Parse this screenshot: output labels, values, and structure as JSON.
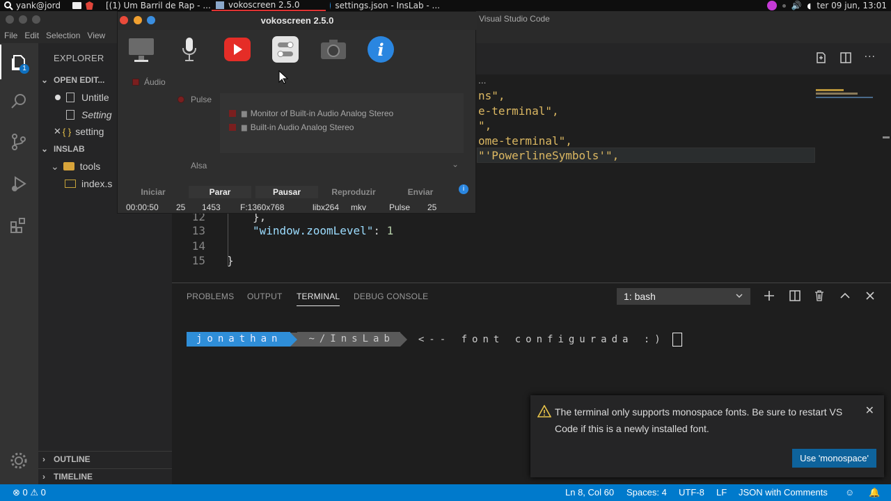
{
  "sysbar": {
    "user": "yank@jord",
    "tasks": [
      "[(1) Um Barril de Rap - ...",
      "vokoscreen 2.5.0",
      "settings.json - InsLab - ..."
    ],
    "clock": "ter 09 jun, 13:01"
  },
  "vscode": {
    "title": "Visual Studio Code",
    "menu": [
      "File",
      "Edit",
      "Selection",
      "View"
    ],
    "explorer": {
      "title": "EXPLORER",
      "open_editors": "OPEN EDIT...",
      "files": [
        "Untitle",
        "Setting",
        "setting"
      ],
      "workspace": "INSLAB",
      "folder": "tools",
      "file": "index.s",
      "outline": "OUTLINE",
      "timeline": "TIMELINE"
    },
    "activity_badge": "1",
    "breadcrumb": "...",
    "code": {
      "frag1": "ns\",",
      "frag2": "e-terminal\",",
      "frag3": "\",",
      "frag4": "ome-terminal\",",
      "frag5": "\"'PowerlineSymbols'\",",
      "line12_num": "12",
      "line12": "},",
      "line13_num": "13",
      "line13_key": "\"window.zoomLevel\"",
      "line13_colon": ": ",
      "line13_val": "1",
      "line14_num": "14",
      "line15_num": "15",
      "line15": "}"
    },
    "panel": {
      "tabs": [
        "PROBLEMS",
        "OUTPUT",
        "TERMINAL",
        "DEBUG CONSOLE"
      ],
      "terminal_select": "1: bash",
      "prompt_user": "jonathan",
      "prompt_dir": "~/InsLab",
      "prompt_rest": "<-- font configurada :)"
    },
    "notification": {
      "message": "The terminal only supports monospace fonts. Be sure to restart VS Code if this is a newly installed font.",
      "button": "Use 'monospace'"
    },
    "status": {
      "errors": "0",
      "warnings": "0",
      "position": "Ln 8, Col 60",
      "spaces": "Spaces: 4",
      "encoding": "UTF-8",
      "eol": "LF",
      "language": "JSON with Comments"
    }
  },
  "voko": {
    "title": "vokoscreen 2.5.0",
    "audio_label": "Áudio",
    "pulse_label": "Pulse",
    "alsa_label": "Alsa",
    "devices": [
      "Monitor of Built-in Audio Analog Stereo",
      "Built-in Audio Analog Stereo"
    ],
    "buttons": [
      "Iniciar",
      "Parar",
      "Pausar",
      "Reproduzir",
      "Enviar"
    ],
    "stats": {
      "time": "00:00:50",
      "fps": "25",
      "frames": "1453",
      "format": "F:1360x768",
      "codec": "libx264",
      "container": "mkv",
      "audio": "Pulse",
      "fps2": "25"
    }
  }
}
